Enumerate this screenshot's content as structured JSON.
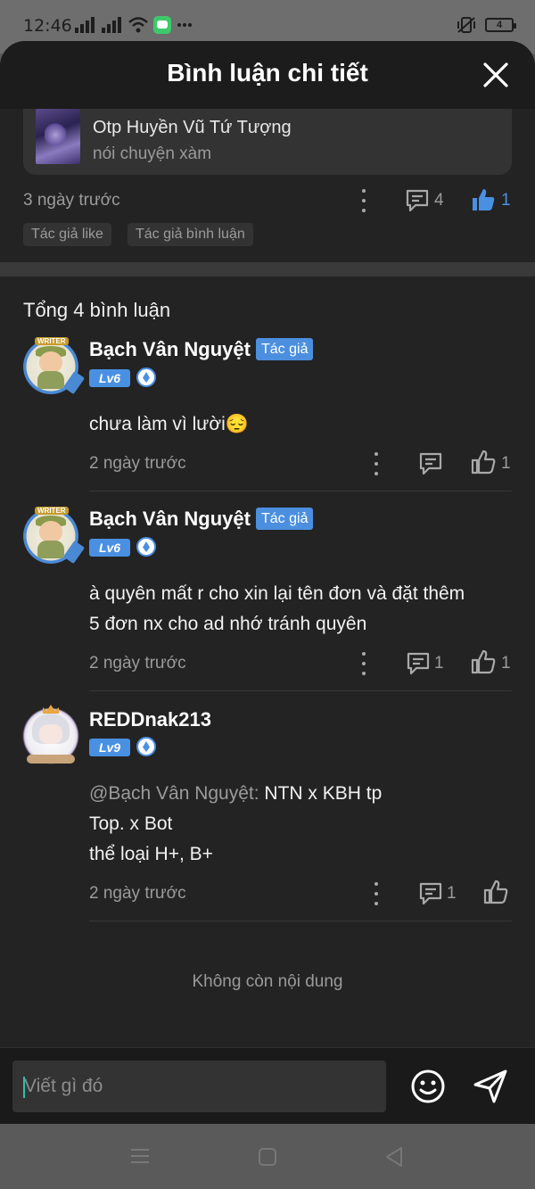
{
  "status_bar": {
    "time": "12:46",
    "battery_level": "4",
    "icons": [
      "signal-icon",
      "signal-icon",
      "wifi-icon",
      "message-app-icon",
      "more-icon",
      "mute-vibrate-icon",
      "battery-icon"
    ]
  },
  "header": {
    "title": "Bình luận chi tiết"
  },
  "post": {
    "title": "Otp Huyền Vũ Tứ Tượng",
    "subtitle": "nói chuyện xàm",
    "time": "3 ngày trước",
    "comment_count": "4",
    "like_count": "1",
    "tags": [
      "Tác giả like",
      "Tác giả bình luận"
    ]
  },
  "comments_section": {
    "total": "Tổng 4 bình luận",
    "items": [
      {
        "name": "Bạch Vân Nguyệt",
        "author_badge": "Tác giả",
        "level": "Lv6",
        "text": "chưa làm vì lười😔",
        "time": "2 ngày trước",
        "reply_count": "",
        "like_count": "1"
      },
      {
        "name": "Bạch Vân Nguyệt",
        "author_badge": "Tác giả",
        "level": "Lv6",
        "text_line1": "à quyên mất r cho xin lại tên đơn và đặt thêm",
        "text_line2": "5 đơn nx cho ad nhớ tránh quyên",
        "time": "2 ngày trước",
        "reply_count": "1",
        "like_count": "1"
      },
      {
        "name": "REDDnak213",
        "level": "Lv9",
        "mention": "@Bạch Vân Nguyệt:",
        "text_line1": " NTN x KBH tp",
        "text_line2": "Top. x Bot",
        "text_line3": "thể loại H+, B+",
        "time": "2 ngày trước",
        "reply_count": "1",
        "like_count": ""
      }
    ]
  },
  "end_text": "Không còn nội dung",
  "composer": {
    "placeholder": "Viết gì đó"
  },
  "colors": {
    "background": "#232323",
    "accent_blue": "#4a90e2",
    "text_secondary": "#9b9b9b"
  }
}
